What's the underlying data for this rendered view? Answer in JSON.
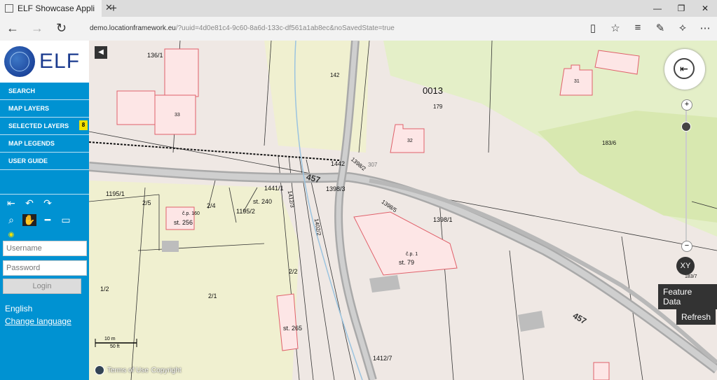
{
  "browser": {
    "tab_title": "ELF Showcase Applicatic",
    "url_domain": "demo.locationframework.eu",
    "url_path": "/?uuid=4d0e81c4-9c60-8a6d-133c-df561a1ab8ec&noSavedState=true"
  },
  "sidebar": {
    "logo_text": "ELF",
    "menu": [
      {
        "label": "SEARCH"
      },
      {
        "label": "MAP LAYERS"
      },
      {
        "label": "SELECTED LAYERS",
        "badge": "8"
      },
      {
        "label": "MAP LEGENDS"
      },
      {
        "label": "USER GUIDE"
      }
    ],
    "username_placeholder": "Username",
    "password_placeholder": "Password",
    "login_label": "Login",
    "language": "English",
    "change_language": "Change language"
  },
  "map": {
    "labels": [
      {
        "text": "136/1"
      },
      {
        "text": "33"
      },
      {
        "text": "142"
      },
      {
        "text": "0013"
      },
      {
        "text": "179"
      },
      {
        "text": "31"
      },
      {
        "text": "32"
      },
      {
        "text": "183/6"
      },
      {
        "text": "1442"
      },
      {
        "text": "1398/2"
      },
      {
        "text": "307"
      },
      {
        "text": "457"
      },
      {
        "text": "1398/3"
      },
      {
        "text": "1441/1"
      },
      {
        "text": "1195/1"
      },
      {
        "text": "2/5"
      },
      {
        "text": "2/4"
      },
      {
        "text": "st. 240"
      },
      {
        "text": "1195/2"
      },
      {
        "text": "1398/5"
      },
      {
        "text": "1398/1"
      },
      {
        "text": "č.p. 160"
      },
      {
        "text": "st. 256"
      },
      {
        "text": "č.p. 1"
      },
      {
        "text": "st. 79"
      },
      {
        "text": "2/2"
      },
      {
        "text": "1/2"
      },
      {
        "text": "2/1"
      },
      {
        "text": "st. 265"
      },
      {
        "text": "1412/7"
      },
      {
        "text": "183/7"
      },
      {
        "text": "457"
      },
      {
        "text": "1402/2"
      },
      {
        "text": "1412/3"
      }
    ],
    "scale_metric": "10 m",
    "scale_imperial": "50 ft",
    "terms": "Terms of Use",
    "copyright": "Copyright",
    "xy_label": "XY",
    "feature_data_label": "Feature Data",
    "refresh_label": "Refresh"
  }
}
